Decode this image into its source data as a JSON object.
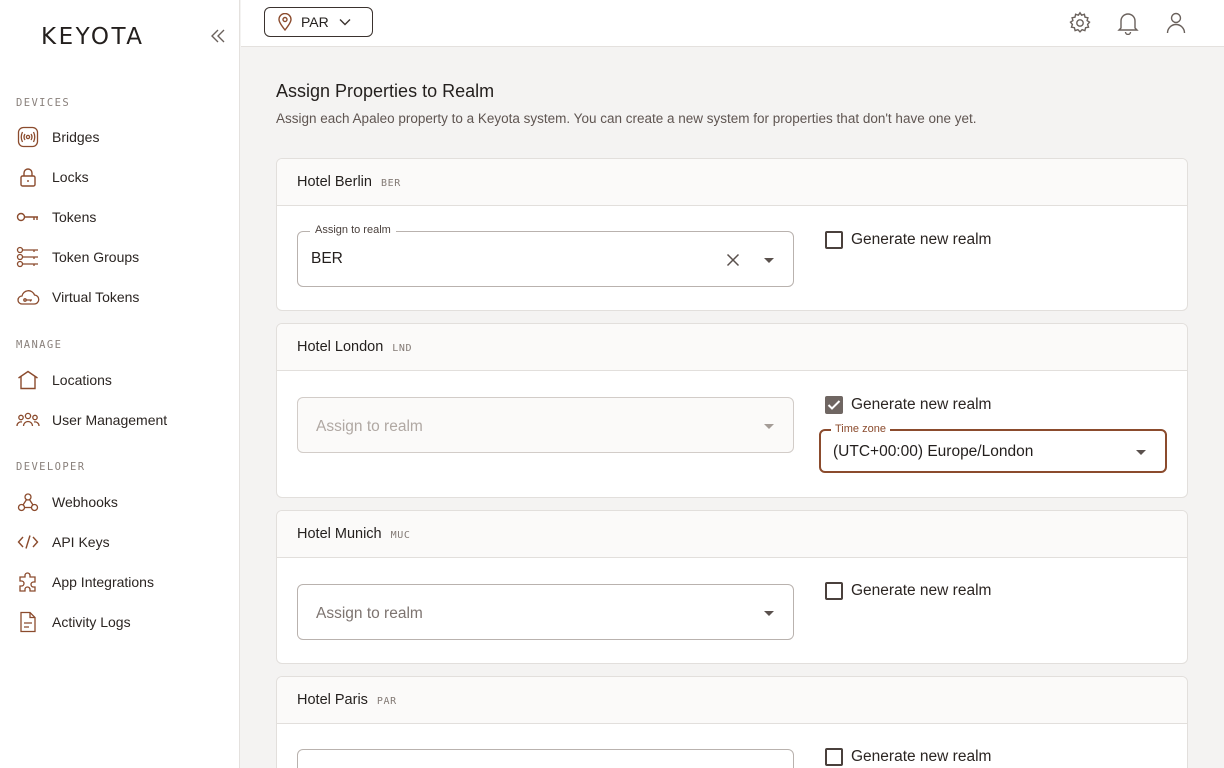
{
  "sidebar": {
    "brand": "KEYOTA",
    "sections": [
      {
        "label": "DEVICES",
        "items": [
          {
            "label": "Bridges",
            "icon": "bridge-icon"
          },
          {
            "label": "Locks",
            "icon": "lock-icon"
          },
          {
            "label": "Tokens",
            "icon": "key-icon"
          },
          {
            "label": "Token Groups",
            "icon": "token-groups-icon"
          },
          {
            "label": "Virtual Tokens",
            "icon": "cloud-icon"
          }
        ]
      },
      {
        "label": "MANAGE",
        "items": [
          {
            "label": "Locations",
            "icon": "home-icon"
          },
          {
            "label": "User Management",
            "icon": "users-icon"
          }
        ]
      },
      {
        "label": "DEVELOPER",
        "items": [
          {
            "label": "Webhooks",
            "icon": "webhook-icon"
          },
          {
            "label": "API Keys",
            "icon": "code-icon"
          },
          {
            "label": "App Integrations",
            "icon": "puzzle-icon"
          },
          {
            "label": "Activity Logs",
            "icon": "document-icon"
          }
        ]
      }
    ]
  },
  "topbar": {
    "location": "PAR"
  },
  "main": {
    "title": "Assign Properties to Realm",
    "subtitle": "Assign each Apaleo property to a Keyota system. You can create a new system for properties that don't have one yet.",
    "select_label": "Assign to realm",
    "checkbox_label": "Generate new realm",
    "timezone_label": "Time zone",
    "properties": [
      {
        "name": "Hotel Berlin",
        "code": "BER",
        "realm": "BER",
        "generate": false
      },
      {
        "name": "Hotel London",
        "code": "LND",
        "realm": "",
        "generate": true,
        "timezone": "(UTC+00:00) Europe/London"
      },
      {
        "name": "Hotel Munich",
        "code": "MUC",
        "realm": "",
        "generate": false
      },
      {
        "name": "Hotel Paris",
        "code": "PAR",
        "realm": "",
        "generate": false
      }
    ]
  },
  "colors": {
    "accent": "#8b4b2d",
    "icon": "#8b4b2d",
    "text": "#231f1d"
  }
}
